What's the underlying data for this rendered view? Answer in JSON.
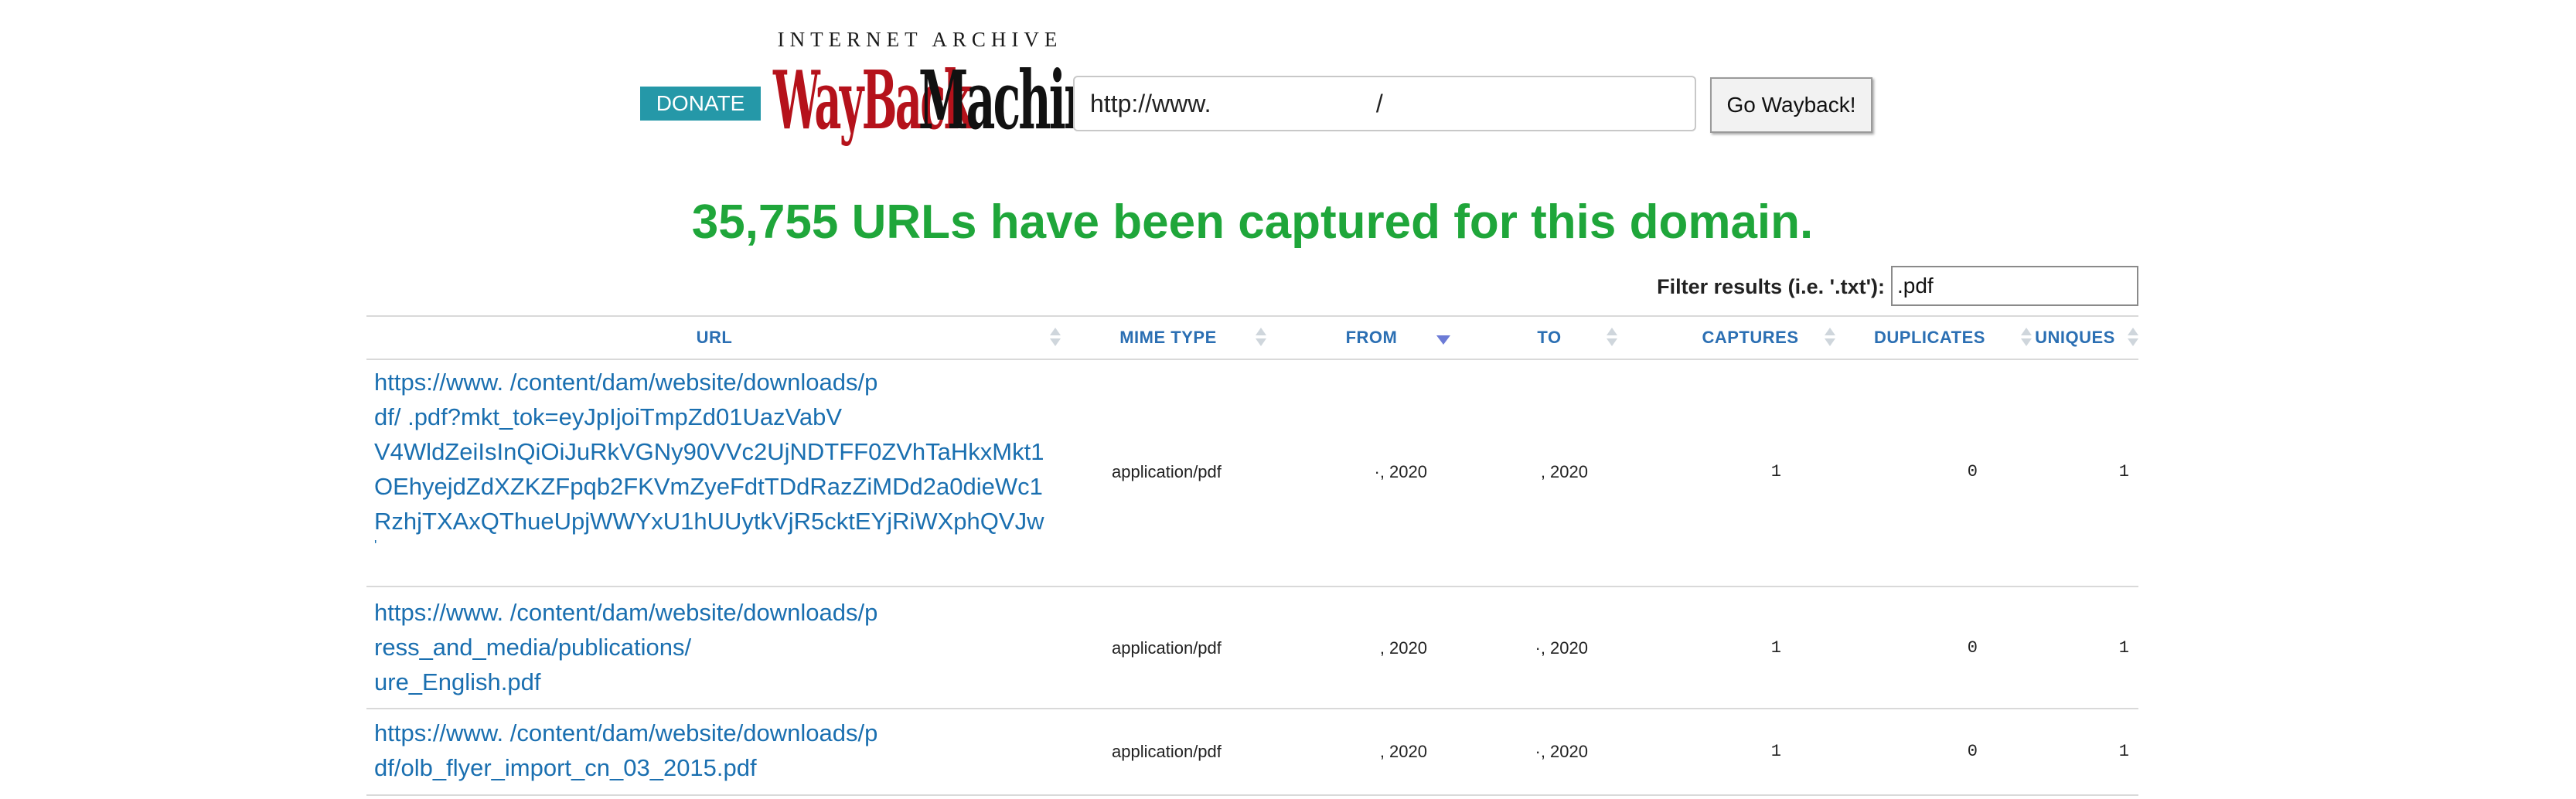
{
  "header": {
    "donate_label": "DONATE",
    "logo_top": "INTERNET ARCHIVE",
    "logo_wayback": "WayBack",
    "logo_machine": "Machine",
    "url_value": "http://www.                        /",
    "go_label": "Go Wayback!"
  },
  "headline": "35,755 URLs have been captured for this domain.",
  "filter": {
    "label": "Filter results (i.e. '.txt'):",
    "value": ".pdf"
  },
  "table": {
    "columns": [
      "URL",
      "MIME TYPE",
      "FROM",
      "TO",
      "CAPTURES",
      "DUPLICATES",
      "UNIQUES"
    ],
    "sorted_column": "FROM",
    "rows": [
      {
        "url_lines": [
          "https://www.                            /content/dam/website/downloads/p",
          "df/                              .pdf?mkt_tok=eyJpIjoiTmpZd01UazVabV",
          "V4WldZeiIsInQiOiJuRkVGNy90VVc2UjNDTFF0ZVhTaHkxMkt1",
          "OEhyejdZdXZKZFpqb2FKVmZyeFdtTDdRazZiMDd2a0dieWc1",
          "RzhjTXAxQThueUpjWWYxU1hUUytkVjR5cktEYjRiWXphQVJw",
          "'"
        ],
        "mime": "application/pdf",
        "from": "·, 2020",
        "to": ", 2020",
        "captures": "1",
        "duplicates": "0",
        "uniques": "1"
      },
      {
        "url_lines": [
          "https://www.                            /content/dam/website/downloads/p",
          "ress_and_media/publications/",
          "ure_English.pdf"
        ],
        "mime": "application/pdf",
        "from": ", 2020",
        "to": "·, 2020",
        "captures": "1",
        "duplicates": "0",
        "uniques": "1"
      },
      {
        "url_lines": [
          "https://www.                            /content/dam/website/downloads/p",
          "df/olb_flyer_import_cn_03_2015.pdf"
        ],
        "mime": "application/pdf",
        "from": ", 2020",
        "to": "·, 2020",
        "captures": "1",
        "duplicates": "0",
        "uniques": "1"
      }
    ]
  }
}
